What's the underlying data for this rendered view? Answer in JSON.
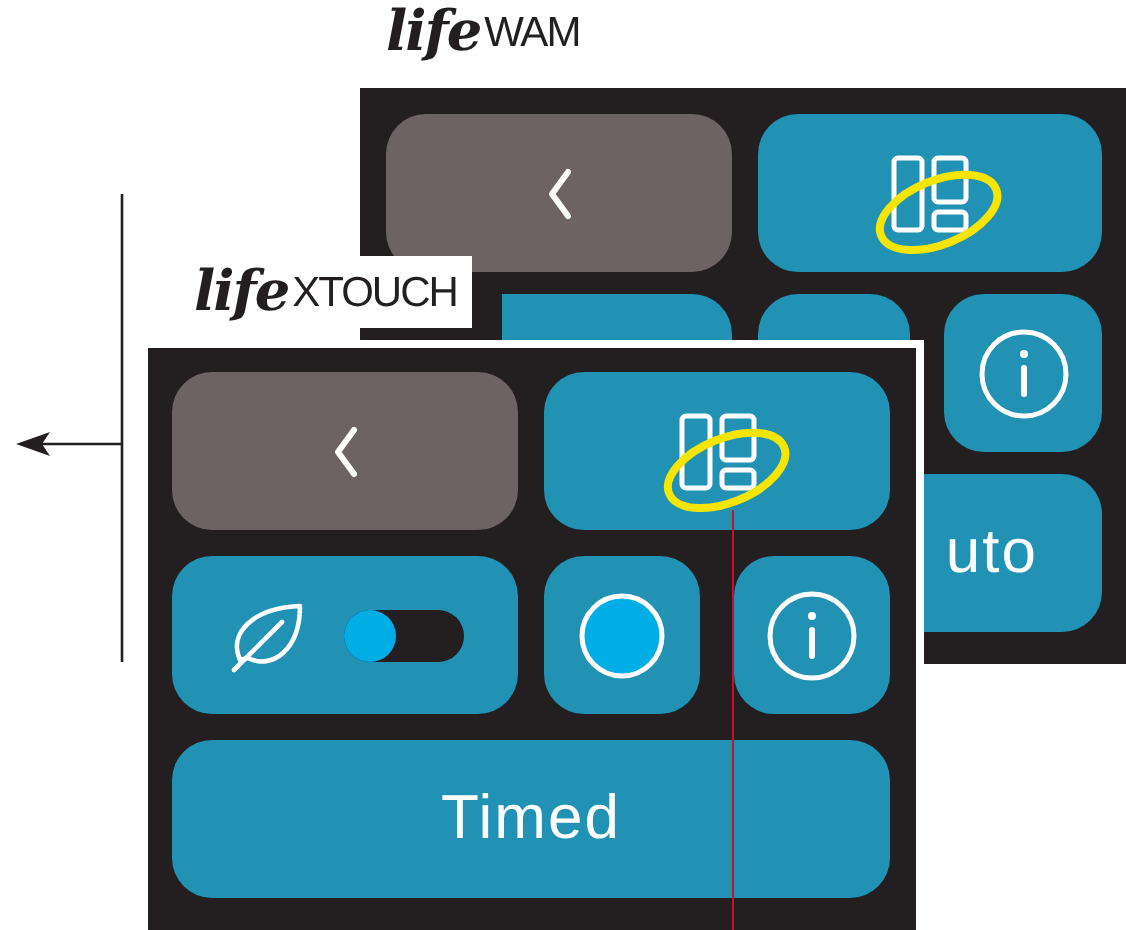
{
  "panels": [
    {
      "logo_script": "life",
      "model": "WAM",
      "buttons": [
        {
          "kind": "back"
        },
        {
          "kind": "layout",
          "highlighted": true
        },
        {
          "kind": "blank"
        },
        {
          "kind": "blank"
        },
        {
          "kind": "info"
        },
        {
          "kind": "text",
          "label": "uto"
        }
      ]
    },
    {
      "logo_script": "life",
      "model": "XTOUCH",
      "buttons": [
        {
          "kind": "back"
        },
        {
          "kind": "layout",
          "highlighted": true
        },
        {
          "kind": "eco",
          "on": false
        },
        {
          "kind": "color"
        },
        {
          "kind": "info"
        },
        {
          "kind": "text",
          "label": "Timed"
        }
      ]
    }
  ]
}
